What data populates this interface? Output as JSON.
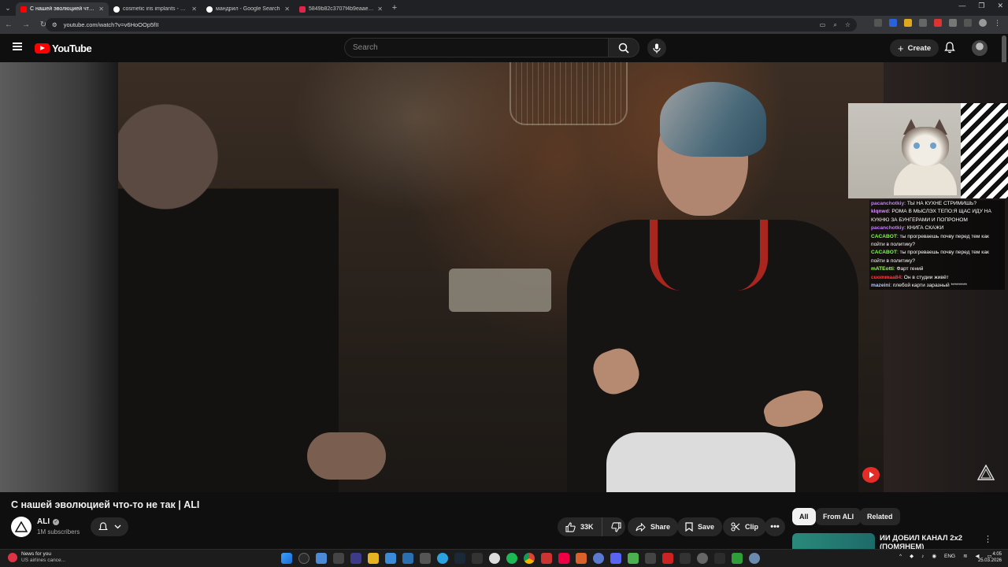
{
  "browser": {
    "tabs": [
      {
        "label": "С нашей эволюцией что-то не",
        "color": "#ff0000",
        "active": true
      },
      {
        "label": "cosmetic iris implants - Google",
        "color": "#ffffff",
        "active": false
      },
      {
        "label": "мандрил - Google Search",
        "color": "#ffffff",
        "active": false
      },
      {
        "label": "5849b82c3707f4b9eaaee0388b",
        "color": "#e0244a",
        "active": false
      }
    ],
    "url": "youtube.com/watch?v=v6HoOOp5fII"
  },
  "header": {
    "logo_text": "YouTube",
    "search_placeholder": "Search",
    "create_label": "Create"
  },
  "overlay": {
    "chat": [
      {
        "user": "pacanchotkiy",
        "color": "#c77dff",
        "text": "ТЫ НА КУХНЕ СТРИМИШЬ?"
      },
      {
        "user": "klqnwd",
        "color": "#d98cff",
        "text": "РОМА В МЫСЛЭХ ТЕПО:Я ЩАС ИДУ НА КУКНЮ ЗА БУНГЕРАМИ И ПОПРОНОМ"
      },
      {
        "user": "pacanchotkiy",
        "color": "#c77dff",
        "text": "КНИГА СКАЖИ"
      },
      {
        "user": "CACABOT",
        "color": "#7cfc4a",
        "text": "ты прогреваешь почву перед тем как пойти в политику?"
      },
      {
        "user": "CACABOT",
        "color": "#7cfc4a",
        "text": "ты прогреваешь почву перед тем как пойти в политику?"
      },
      {
        "user": "mATEotti",
        "color": "#9cff57",
        "text": "Фарт гений"
      },
      {
        "user": "cuommaa84",
        "color": "#ff3b3b",
        "text": "Он в студии живёт"
      },
      {
        "user": "mazeini",
        "color": "#b5c8ff",
        "text": "плебой карти заразный ********"
      }
    ]
  },
  "video": {
    "title": "С нашей эволюцией что-то не так | ALI",
    "channel": "ALI",
    "subscribers": "1M subscribers",
    "likes": "33K",
    "share_label": "Share",
    "save_label": "Save",
    "clip_label": "Clip"
  },
  "related": {
    "chips": [
      {
        "label": "All",
        "active": true
      },
      {
        "label": "From ALI",
        "active": false
      },
      {
        "label": "Related",
        "active": false
      }
    ],
    "first_title": "ИИ ДОБИЛ КАНАЛ 2x2 (ПОМЯНЕМ)"
  },
  "taskbar": {
    "news_title": "News for you",
    "news_sub": "US airlines cance...",
    "lang": "ENG",
    "time": "4:05",
    "date": "25.03.2026"
  }
}
